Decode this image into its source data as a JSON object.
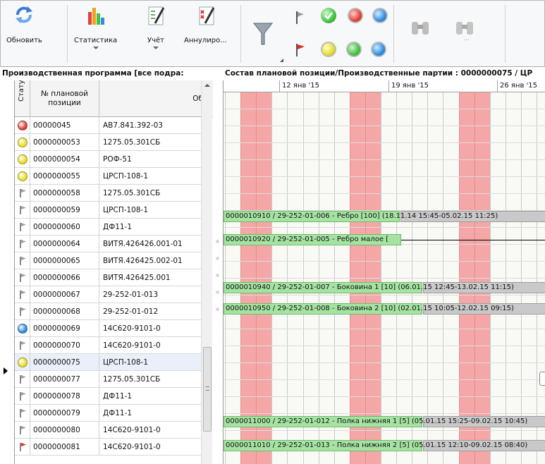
{
  "ribbon": {
    "refresh_label": "Обновить",
    "stats_label": "Статистика",
    "accounting_label": "Учёт",
    "cancel_label": "Аннулиро..."
  },
  "panels": {
    "left_title": "Производственная программа  [все подра:",
    "right_title": "Состав плановой позиции/Производственные партии : 0000000075 / ЦР"
  },
  "grid": {
    "col_status": "Статус",
    "col_number": "№ плановой позиции",
    "col_name": "Об",
    "rows": [
      {
        "status": "red-circle",
        "number": "00000045",
        "name": "АВ7.841.392-03"
      },
      {
        "status": "yellow-circle",
        "number": "0000000053",
        "name": "1275.05.301СБ"
      },
      {
        "status": "yellow-circle",
        "number": "0000000054",
        "name": "РОФ-51"
      },
      {
        "status": "yellow-circle",
        "number": "0000000055",
        "name": "ЦРСП-108-1"
      },
      {
        "status": "grey-flag",
        "number": "0000000058",
        "name": "1275.05.301СБ"
      },
      {
        "status": "grey-flag",
        "number": "0000000059",
        "name": "ЦРСП-108-1"
      },
      {
        "status": "grey-flag",
        "number": "0000000060",
        "name": "ДФ11-1"
      },
      {
        "status": "grey-flag",
        "number": "0000000064",
        "name": "ВИТЯ.426426.001-01"
      },
      {
        "status": "grey-flag",
        "number": "0000000065",
        "name": "ВИТЯ.426425.002-01"
      },
      {
        "status": "grey-flag",
        "number": "0000000066",
        "name": "ВИТЯ.426425.001"
      },
      {
        "status": "grey-flag",
        "number": "0000000067",
        "name": "29-252-01-013"
      },
      {
        "status": "grey-flag",
        "number": "0000000068",
        "name": "29-252-01-012"
      },
      {
        "status": "blue-circle",
        "number": "0000000069",
        "name": "14С620-9101-0"
      },
      {
        "status": "grey-flag",
        "number": "0000000070",
        "name": "14С620-9101-0"
      },
      {
        "status": "yellow-circle",
        "number": "0000000075",
        "name": "ЦРСП-108-1",
        "selected": true
      },
      {
        "status": "grey-flag",
        "number": "0000000077",
        "name": "1275.05.301СБ"
      },
      {
        "status": "grey-flag",
        "number": "0000000078",
        "name": "ДФ11-1"
      },
      {
        "status": "grey-flag",
        "number": "0000000079",
        "name": "ДФ11-1"
      },
      {
        "status": "grey-flag",
        "number": "0000000080",
        "name": "14С620-9101-0"
      },
      {
        "status": "red-flag",
        "number": "0000000081",
        "name": "14С620-9101-0"
      }
    ]
  },
  "gantt": {
    "ticks": [
      "12 янв '15",
      "19 янв '15",
      "26 янв '15"
    ],
    "bars": [
      {
        "label": "0000010910 / 29-252-01-006 - Ребро [100] (18.11.14 15:45-05.02.15 11:25)"
      },
      {
        "label": "0000010920 / 29-252-01-005 - Ребро малое ["
      },
      {
        "label": "0000010940 / 29-252-01-007 - Боковина 1 [10] (06.01.15 12:45-13.02.15 11:15)"
      },
      {
        "label": "0000010950 / 29-252-01-008 - Боковина 2 [10] (02.01.15 10:05-12.02.15 09:15)"
      },
      {
        "label": "0000011000 / 29-252-01-012 - Полка нижняя 1 [5] (05.01.15 15:25-09.02.15 10:45)"
      },
      {
        "label": "0000011010 / 29-252-01-013 - Полка нижняя 2 [5] (05.01.15 12:10-09.02.15 08:40)"
      }
    ]
  },
  "colors": {
    "red": "#e2423a",
    "yellow": "#e8df2a",
    "green": "#43c23f",
    "blue": "#2f8fe3",
    "weekend": "#f4a7a6",
    "bar": "#a6e3a3"
  }
}
